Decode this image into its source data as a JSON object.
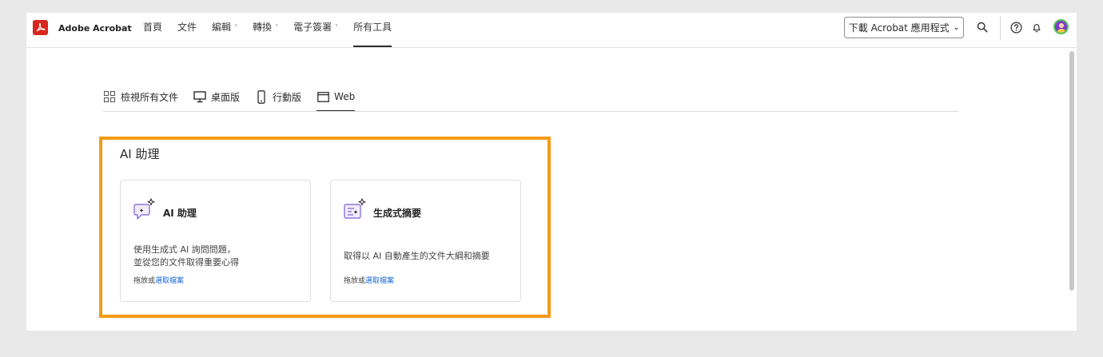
{
  "app": {
    "brand": "Adobe Acrobat",
    "logo_icon": "acrobat-logo-icon",
    "brand_color": "#d7261e"
  },
  "nav": {
    "items": [
      {
        "label": "首頁",
        "dropdown": false
      },
      {
        "label": "文件",
        "dropdown": false
      },
      {
        "label": "編輯",
        "dropdown": true
      },
      {
        "label": "轉換",
        "dropdown": true
      },
      {
        "label": "電子簽署",
        "dropdown": true
      },
      {
        "label": "所有工具",
        "dropdown": false,
        "active": true
      }
    ],
    "chevron": "˅"
  },
  "header": {
    "download_label": "下載 Acrobat 應用程式",
    "download_chevron": "⌄",
    "icons": [
      "search-icon",
      "help-icon",
      "bell-icon",
      "avatar"
    ]
  },
  "subtabs": [
    {
      "label": "檢視所有文件",
      "icon": "grid-icon"
    },
    {
      "label": "桌面版",
      "icon": "desktop-icon"
    },
    {
      "label": "行動版",
      "icon": "mobile-icon"
    },
    {
      "label": "Web",
      "icon": "browser-window-icon",
      "active": true
    }
  ],
  "section": {
    "title": "AI 助理",
    "highlight_color": "#f59b16",
    "cards": [
      {
        "title": "AI 助理",
        "icon": "ai-chat-icon",
        "desc_lines": [
          "使用生成式 AI 詢問問題，",
          "並從您的文件取得重要心得"
        ],
        "action_prefix": "拖放或",
        "action_link": "選取檔案"
      },
      {
        "title": "生成式摘要",
        "icon": "ai-summary-icon",
        "desc_lines": [
          "取得以 AI 自動產生的文件大綱和摘要"
        ],
        "action_prefix": "拖放或",
        "action_link": "選取檔案"
      }
    ]
  },
  "colors": {
    "link": "#1769d8",
    "accent_purple": "#7b5cd6"
  }
}
